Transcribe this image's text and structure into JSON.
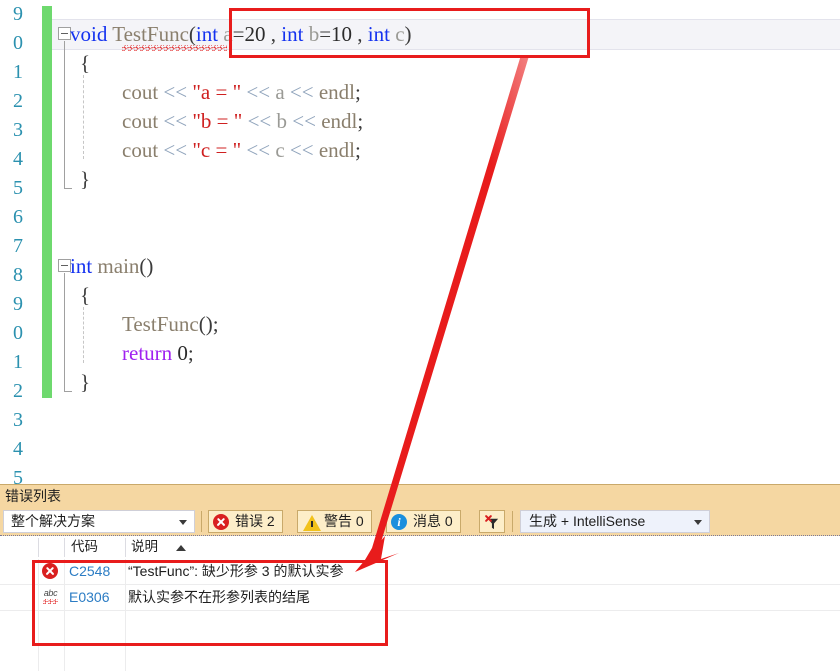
{
  "editor": {
    "line_numbers": [
      "9",
      "0",
      "1",
      "2",
      "3",
      "4",
      "5",
      "6",
      "7",
      "8",
      "9",
      "0",
      "1",
      "2",
      "3",
      "4",
      "5"
    ],
    "code_lines": [
      {
        "indent": 0,
        "tokens": [
          {
            "t": "void",
            "c": "kw"
          },
          {
            "t": " ",
            "c": "pln"
          },
          {
            "t": "TestFunc",
            "c": "fn"
          },
          {
            "t": "(",
            "c": "pln"
          },
          {
            "t": "int",
            "c": "kw"
          },
          {
            "t": " ",
            "c": "pln"
          },
          {
            "t": "a",
            "c": "id"
          },
          {
            "t": "=",
            "c": "pln"
          },
          {
            "t": "20",
            "c": "num"
          },
          {
            "t": " , ",
            "c": "pln"
          },
          {
            "t": "int",
            "c": "kw"
          },
          {
            "t": " ",
            "c": "pln"
          },
          {
            "t": "b",
            "c": "id"
          },
          {
            "t": "=",
            "c": "pln"
          },
          {
            "t": "10",
            "c": "num"
          },
          {
            "t": " , ",
            "c": "pln"
          },
          {
            "t": "int",
            "c": "kw"
          },
          {
            "t": " ",
            "c": "pln"
          },
          {
            "t": "c",
            "c": "id"
          },
          {
            "t": ")",
            "c": "pln"
          }
        ]
      },
      {
        "indent": 0,
        "tokens": [
          {
            "t": "{",
            "c": "pln"
          }
        ]
      },
      {
        "indent": 0,
        "tokens": [
          {
            "t": "cout",
            "c": "fn"
          },
          {
            "t": " ",
            "c": "pln"
          },
          {
            "t": "<<",
            "c": "op"
          },
          {
            "t": " ",
            "c": "pln"
          },
          {
            "t": "\"a = \"",
            "c": "str"
          },
          {
            "t": " ",
            "c": "pln"
          },
          {
            "t": "<<",
            "c": "op"
          },
          {
            "t": " ",
            "c": "pln"
          },
          {
            "t": "a",
            "c": "id"
          },
          {
            "t": " ",
            "c": "pln"
          },
          {
            "t": "<<",
            "c": "op"
          },
          {
            "t": " ",
            "c": "pln"
          },
          {
            "t": "endl",
            "c": "fn"
          },
          {
            "t": ";",
            "c": "pln"
          }
        ]
      },
      {
        "indent": 0,
        "tokens": [
          {
            "t": "cout",
            "c": "fn"
          },
          {
            "t": " ",
            "c": "pln"
          },
          {
            "t": "<<",
            "c": "op"
          },
          {
            "t": " ",
            "c": "pln"
          },
          {
            "t": "\"b = \"",
            "c": "str"
          },
          {
            "t": " ",
            "c": "pln"
          },
          {
            "t": "<<",
            "c": "op"
          },
          {
            "t": " ",
            "c": "pln"
          },
          {
            "t": "b",
            "c": "id"
          },
          {
            "t": " ",
            "c": "pln"
          },
          {
            "t": "<<",
            "c": "op"
          },
          {
            "t": " ",
            "c": "pln"
          },
          {
            "t": "endl",
            "c": "fn"
          },
          {
            "t": ";",
            "c": "pln"
          }
        ]
      },
      {
        "indent": 0,
        "tokens": [
          {
            "t": "cout",
            "c": "fn"
          },
          {
            "t": " ",
            "c": "pln"
          },
          {
            "t": "<<",
            "c": "op"
          },
          {
            "t": " ",
            "c": "pln"
          },
          {
            "t": "\"c = \"",
            "c": "str"
          },
          {
            "t": " ",
            "c": "pln"
          },
          {
            "t": "<<",
            "c": "op"
          },
          {
            "t": " ",
            "c": "pln"
          },
          {
            "t": "c",
            "c": "id"
          },
          {
            "t": " ",
            "c": "pln"
          },
          {
            "t": "<<",
            "c": "op"
          },
          {
            "t": " ",
            "c": "pln"
          },
          {
            "t": "endl",
            "c": "fn"
          },
          {
            "t": ";",
            "c": "pln"
          }
        ]
      },
      {
        "indent": 0,
        "tokens": [
          {
            "t": "}",
            "c": "pln"
          }
        ]
      },
      {
        "indent": 0,
        "tokens": [
          {
            "t": "int",
            "c": "kw"
          },
          {
            "t": " ",
            "c": "pln"
          },
          {
            "t": "main",
            "c": "fn"
          },
          {
            "t": "()",
            "c": "pln"
          }
        ]
      },
      {
        "indent": 0,
        "tokens": [
          {
            "t": "{",
            "c": "pln"
          }
        ]
      },
      {
        "indent": 0,
        "tokens": [
          {
            "t": "TestFunc",
            "c": "fn"
          },
          {
            "t": "();",
            "c": "pln"
          }
        ]
      },
      {
        "indent": 0,
        "tokens": [
          {
            "t": "return",
            "c": "kw2"
          },
          {
            "t": " ",
            "c": "pln"
          },
          {
            "t": "0",
            "c": "num"
          },
          {
            "t": ";",
            "c": "pln"
          }
        ]
      },
      {
        "indent": 0,
        "tokens": [
          {
            "t": "}",
            "c": "pln"
          }
        ]
      }
    ],
    "plain_text_lines": [
      "void TestFunc(int a=20 , int b=10 , int c)",
      "{",
      "    cout << \"a = \" << a << endl;",
      "    cout << \"b = \" << b << endl;",
      "    cout << \"c = \" << c << endl;",
      "}",
      "int main()",
      "{",
      "    TestFunc();",
      "    return 0;",
      "}"
    ]
  },
  "error_panel": {
    "title": "错误列表",
    "scope_filter": "整个解决方案",
    "toggles": [
      {
        "icon": "error-icon",
        "label": "错误 2"
      },
      {
        "icon": "warning-icon",
        "label": "警告 0"
      },
      {
        "icon": "info-icon",
        "label": "消息 0"
      }
    ],
    "clear_filter_icon": "clear-filter-icon",
    "build_source": "生成 + IntelliSense",
    "columns": [
      "代码",
      "说明"
    ],
    "sort_column": "说明",
    "sort_direction": "ascending",
    "rows": [
      {
        "icon": "error-icon",
        "code": "C2548",
        "description": "“TestFunc”: 缺少形参 3 的默认实参"
      },
      {
        "icon": "intellisense-icon",
        "code": "E0306",
        "description": "默认实参不在形参列表的结尾"
      }
    ]
  },
  "annotations": {
    "signature_highlight_box": "red-rectangle-around-function-parameters",
    "error_rows_highlight_box": "red-rectangle-around-error-rows",
    "pointer_arrow": "red-arrow-from-signature-to-error-list",
    "accent_color": "#e81c1c"
  }
}
